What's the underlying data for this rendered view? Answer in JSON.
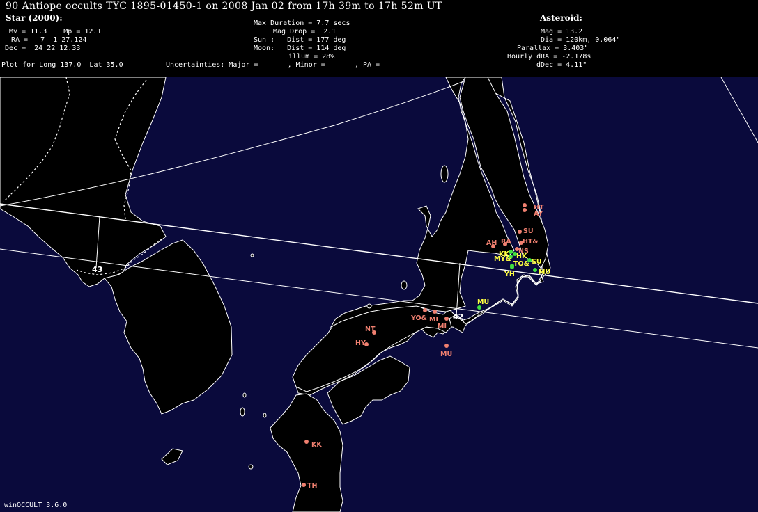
{
  "title": "90 Antiope occults TYC 1895-01450-1 on 2008 Jan 02 from 17h 39m to 17h 52m UT",
  "star": {
    "heading": "Star (2000):",
    "mv_mp": "Mv = 11.3    Mp = 12.1",
    "ra": "RA =   7  1 27.124",
    "dec": "Dec =  24 22 12.33"
  },
  "event": {
    "max_duration": "Max Duration = 7.7 secs",
    "mag_drop": "Mag Drop =  2.1",
    "sun": "Sun :   Dist = 177 deg",
    "moon": "Moon:   Dist = 114 deg",
    "illum": "illum = 28%"
  },
  "asteroid": {
    "heading": "Asteroid:",
    "mag": "Mag = 13.2",
    "dia": "Dia = 120km, 0.064\"",
    "parallax": "Parallax = 3.403\"",
    "hourly_dra": "Hourly dRA = -2.178s",
    "ddec": "dDec = 4.11\""
  },
  "plot_for": "Plot for Long 137.0  Lat 35.0",
  "uncertainties": "Uncertainties: Major =       , Minor =       , PA =",
  "footer": "winOCCULT 3.6.0",
  "map": {
    "colors": {
      "sea": "#0a0a3c",
      "land": "#000000",
      "lines": "#ffffff",
      "observer_red": "#f08070",
      "observer_green": "#40e040",
      "label_yellow": "#ffff40"
    },
    "meridian_labels": [
      "43",
      "42"
    ],
    "observers": [
      {
        "label": "HT",
        "color": "red"
      },
      {
        "label": "AY",
        "color": "red"
      },
      {
        "label": "SU",
        "color": "red"
      },
      {
        "label": "HT&",
        "color": "red"
      },
      {
        "label": "AH",
        "color": "red"
      },
      {
        "label": "RA",
        "color": "red"
      },
      {
        "label": "NS",
        "color": "red"
      },
      {
        "label": "KK",
        "color": "green"
      },
      {
        "label": "HK",
        "color": "green"
      },
      {
        "label": "MY&",
        "color": "green"
      },
      {
        "label": "TO&",
        "color": "green"
      },
      {
        "label": "SU",
        "color": "green"
      },
      {
        "label": "MU",
        "color": "green"
      },
      {
        "label": "YH",
        "color": "green"
      },
      {
        "label": "MU",
        "color": "green"
      },
      {
        "label": "YO&",
        "color": "red"
      },
      {
        "label": "MI",
        "color": "red"
      },
      {
        "label": "MI",
        "color": "red"
      },
      {
        "label": "NT",
        "color": "red"
      },
      {
        "label": "HY",
        "color": "red"
      },
      {
        "label": "MU",
        "color": "red"
      },
      {
        "label": "KK",
        "color": "red"
      },
      {
        "label": "TH",
        "color": "red"
      }
    ]
  }
}
